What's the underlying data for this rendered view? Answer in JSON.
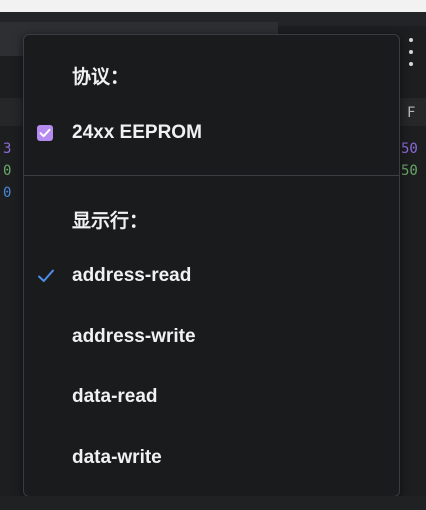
{
  "background": {
    "header_letter": "F",
    "left_fragments": [
      {
        "text": "3",
        "color": "#8e6ad8"
      },
      {
        "text": "0",
        "color": "#6aa86a"
      },
      {
        "text": "0",
        "color": "#4a86d8"
      }
    ],
    "right_fragments": [
      {
        "text": "50",
        "color": "#8e6ad8"
      },
      {
        "text": "50",
        "color": "#6aa86a"
      }
    ]
  },
  "menu": {
    "protocol_title": "协议：",
    "protocols": [
      {
        "label": "24xx EEPROM",
        "checked": true
      }
    ],
    "rows_title": "显示行：",
    "rows": [
      {
        "label": "address-read",
        "selected": true
      },
      {
        "label": "address-write",
        "selected": false
      },
      {
        "label": "data-read",
        "selected": false
      },
      {
        "label": "data-write",
        "selected": false
      }
    ]
  },
  "colors": {
    "checkbox_accent": "#b58bf0",
    "checkmark_accent": "#4f8fe8"
  }
}
